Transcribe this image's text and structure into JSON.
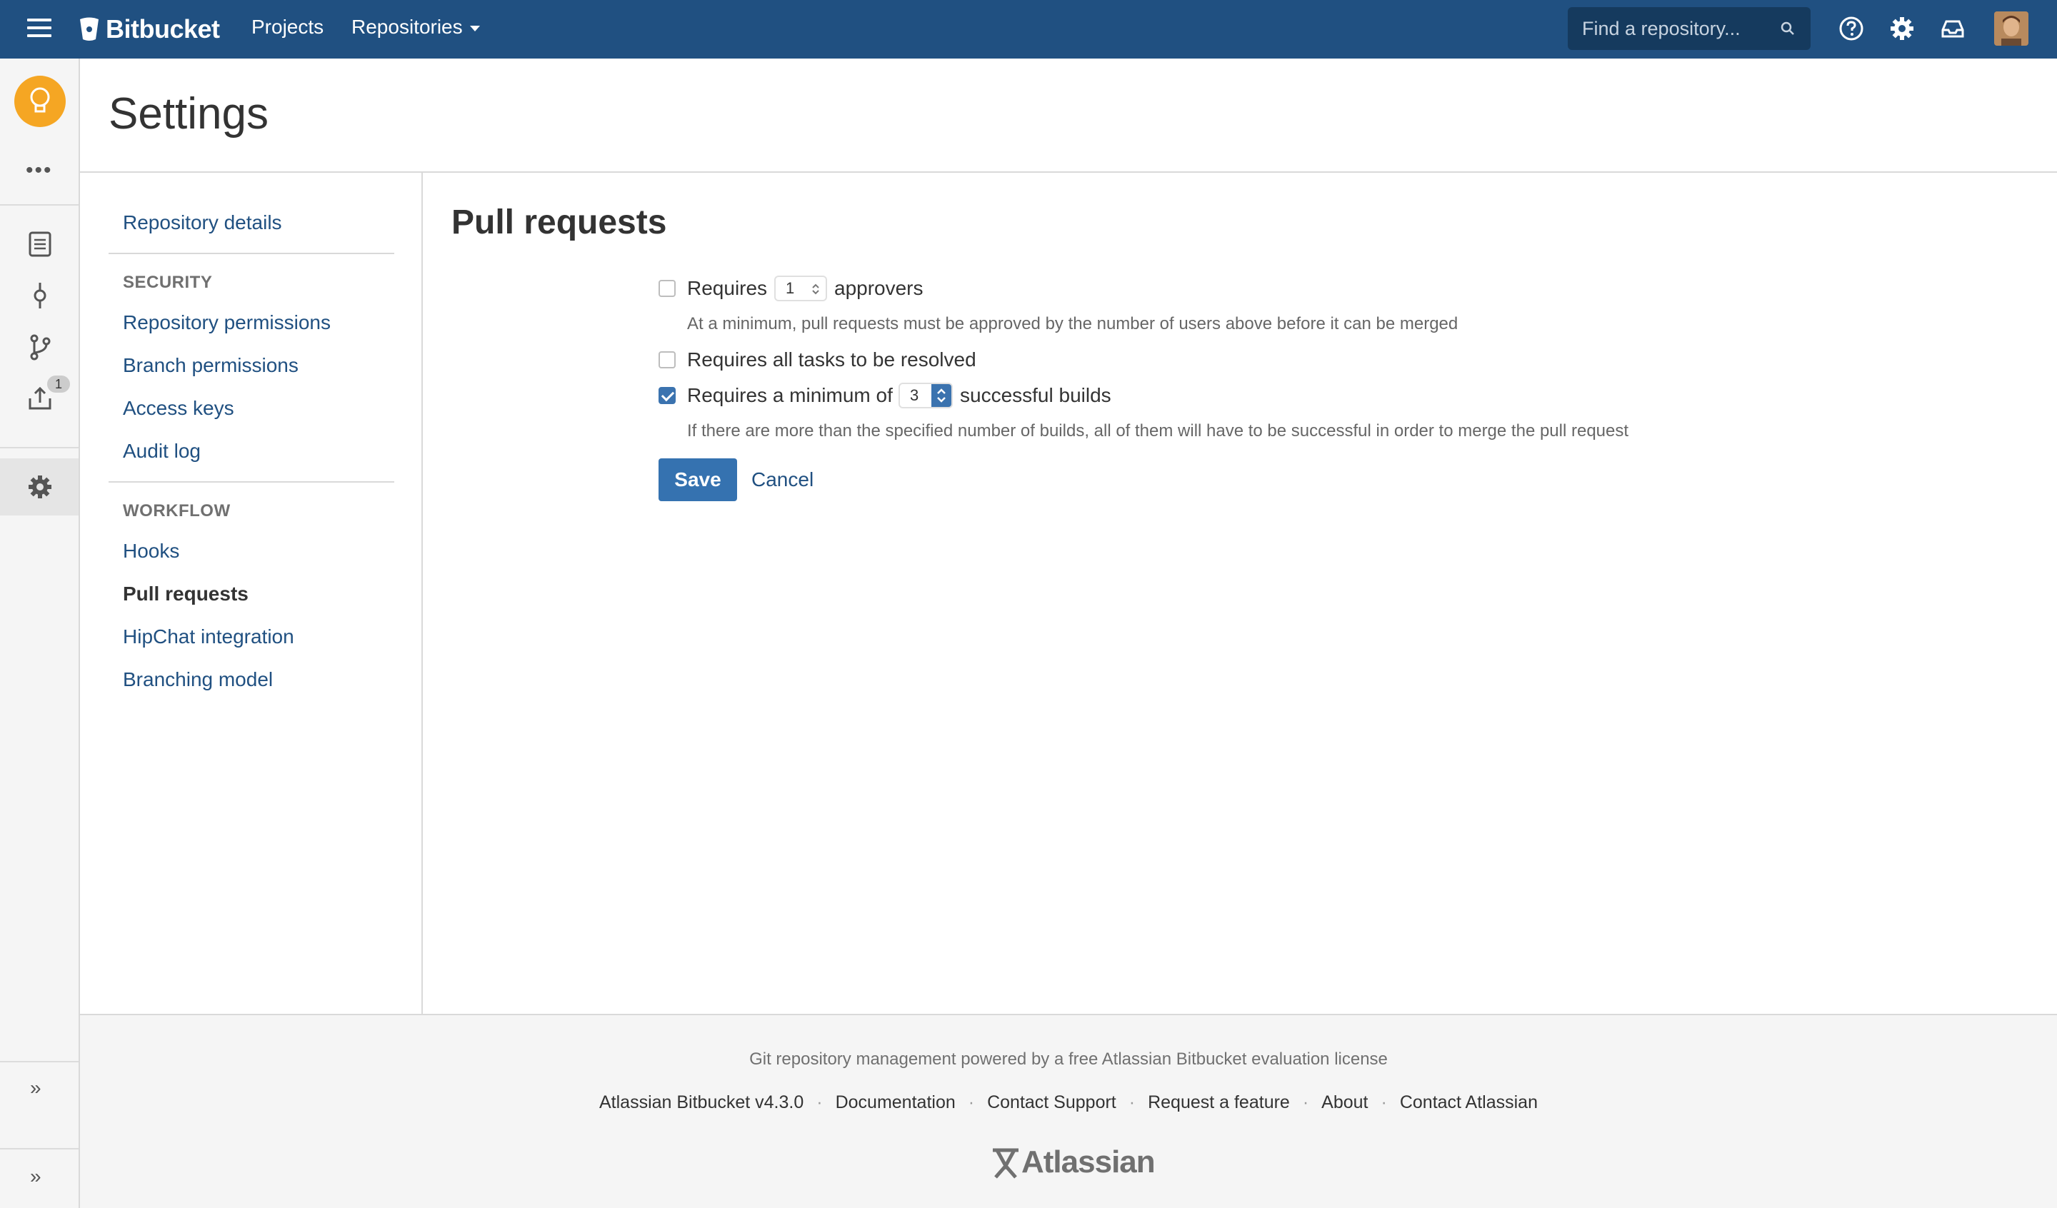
{
  "header": {
    "brand": "Bitbucket",
    "nav": {
      "projects": "Projects",
      "repositories": "Repositories"
    },
    "search": {
      "placeholder": "Find a repository..."
    },
    "colors": {
      "bar": "#205081"
    }
  },
  "sidebar": {
    "badge_count": "1"
  },
  "page": {
    "title": "Settings"
  },
  "settings_nav": {
    "repository_details": "Repository details",
    "security_heading": "SECURITY",
    "repository_permissions": "Repository permissions",
    "branch_permissions": "Branch permissions",
    "access_keys": "Access keys",
    "audit_log": "Audit log",
    "workflow_heading": "WORKFLOW",
    "hooks": "Hooks",
    "pull_requests": "Pull requests",
    "hipchat_integration": "HipChat integration",
    "branching_model": "Branching model"
  },
  "main": {
    "title": "Pull requests",
    "approvers": {
      "prefix": "Requires",
      "value": "1",
      "suffix": "approvers",
      "checked": false,
      "help": "At a minimum, pull requests must be approved by the number of users above before it can be merged"
    },
    "tasks": {
      "label": "Requires all tasks to be resolved",
      "checked": false
    },
    "builds": {
      "prefix": "Requires a minimum of",
      "value": "3",
      "suffix": "successful builds",
      "checked": true,
      "help": "If there are more than the specified number of builds, all of them will have to be successful in order to merge the pull request"
    },
    "save": "Save",
    "cancel": "Cancel"
  },
  "footer": {
    "license": "Git repository management powered by a free Atlassian Bitbucket evaluation license",
    "version": "Atlassian Bitbucket v4.3.0",
    "documentation": "Documentation",
    "contact_support": "Contact Support",
    "request_feature": "Request a feature",
    "about": "About",
    "contact_atlassian": "Contact Atlassian",
    "separator": "·",
    "logo_text": "Atlassian"
  }
}
